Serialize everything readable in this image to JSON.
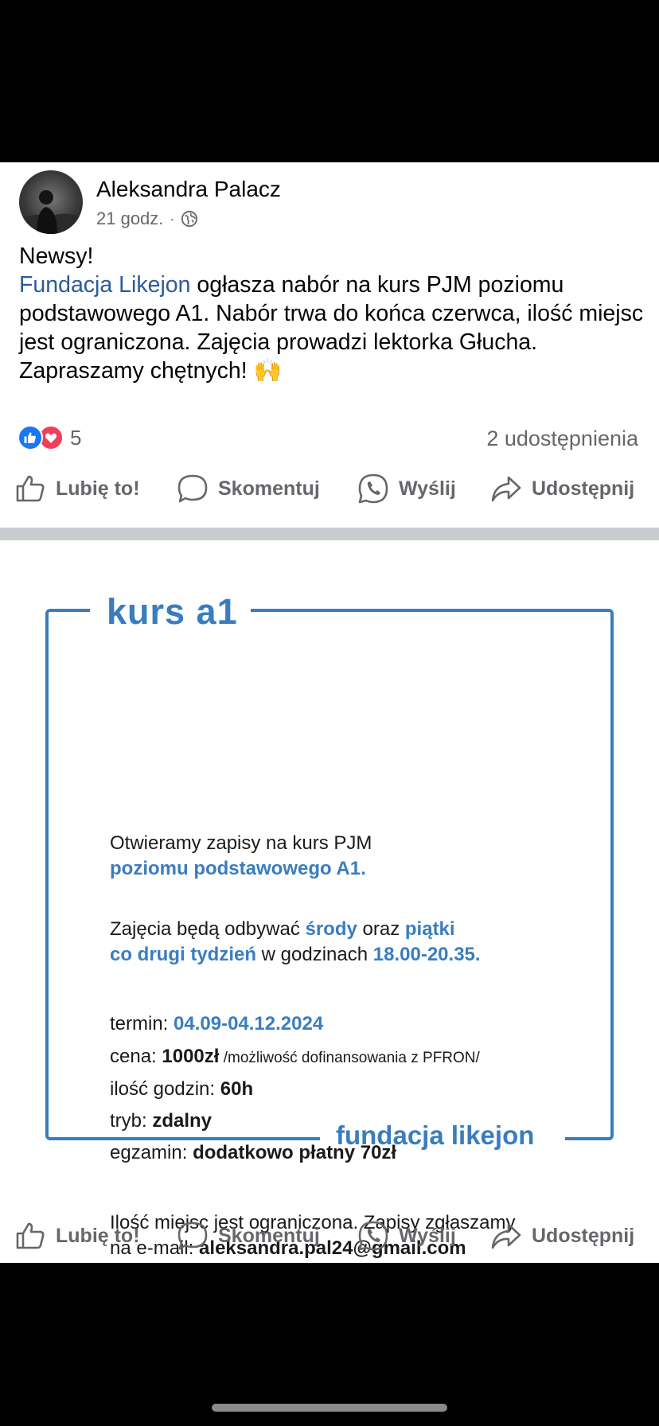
{
  "post": {
    "author": "Aleksandra Palacz",
    "time": "21 godz.",
    "meta_separator": "·",
    "visibility_icon": "globe-icon",
    "text_line1": "Newsy!",
    "link_text": "Fundacja Likejon",
    "text_after_link": " ogłasza nabór na kurs PJM poziomu podstawowego A1. Nabór trwa do końca czerwca, ilość miejsc jest ograniczona. Zajęcia prowadzi lektorka Głucha.",
    "text_last": "Zapraszamy chętnych! 🙌",
    "reaction_count": "5",
    "shares": "2 udostępnienia"
  },
  "actions": {
    "like": "Lubię to!",
    "comment": "Skomentuj",
    "send": "Wyślij",
    "share": "Udostępnij"
  },
  "flyer": {
    "title": "kurs a1",
    "intro_line1": "Otwieramy zapisy na kurs PJM",
    "intro_line2": "poziomu podstawowego A1.",
    "schedule_a": "Zajęcia będą odbywać ",
    "schedule_day1": "środy",
    "schedule_b": " oraz ",
    "schedule_day2": "piątki",
    "schedule_freq": "co drugi tydzień",
    "schedule_c": " w godzinach ",
    "schedule_hours": "18.00-20.35.",
    "term_label": "termin: ",
    "term_value": "04.09-04.12.2024",
    "price_label": "cena: ",
    "price_value": "1000zł",
    "price_note": "  /możliwość dofinansowania z PFRON/",
    "hours_label": "ilość godzin: ",
    "hours_value": "60h",
    "mode_label": "tryb: ",
    "mode_value": "zdalny",
    "exam_label": "egzamin: ",
    "exam_value": "dodatkowo płatny 70zł",
    "contact_line1": "Ilość miejsc jest ograniczona. Zapisy zgłaszamy",
    "contact_label": "na e-mail: ",
    "contact_email": "aleksandra.pal24@gmail.com",
    "footer": "fundacja likejon"
  },
  "colors": {
    "flyer_blue": "#3a7dbf",
    "link_blue": "#2a5b9c",
    "like_blue": "#1877f2",
    "love_red": "#f33e58"
  }
}
